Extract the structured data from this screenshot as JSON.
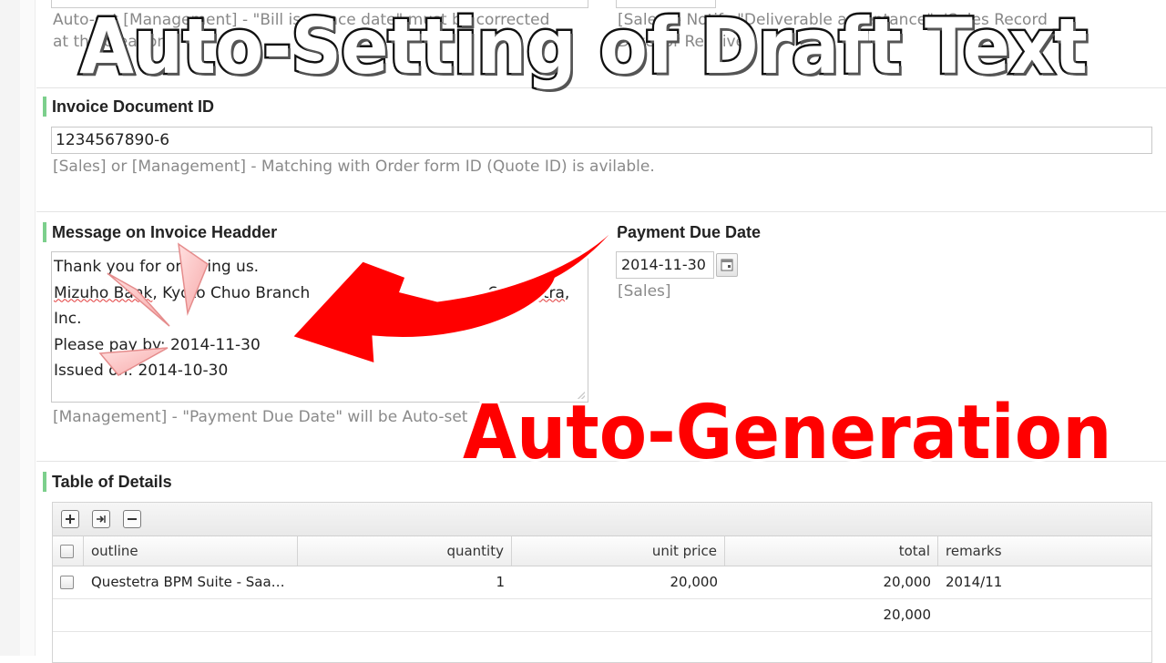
{
  "overlay": {
    "title": "Auto-Setting of Draft Text",
    "generation": "Auto-Generation"
  },
  "top_row": {
    "left_help_line1": "Auto-set [Management] - \"Bill issuance date\" must be corrected",
    "left_help_line2": "at the creation",
    "right_help_line1": "[Sales] - Notify \"Deliverable acceptance\". 'Sales Record",
    "right_help_line2": "Date' or Receive"
  },
  "invoice_id": {
    "label": "Invoice Document ID",
    "value": "1234567890-6",
    "help": "[Sales] or [Management] - Matching with Order form ID (Quote ID) is avilable."
  },
  "message": {
    "label": "Message on Invoice Headder",
    "lines": {
      "l1": "Thank you for ordering us.",
      "l2a": "Mizuho Bank",
      "l2b": ", Kyoto Chuo Branch",
      "l2c": "Questetra",
      "l2d": ",",
      "l3": "Inc.",
      "l4": "Please pay by:  2014-11-30",
      "l5": "Issued on: 2014-10-30"
    },
    "help": "[Management] - \"Payment Due Date\" will be Auto-set"
  },
  "payment_due": {
    "label": "Payment Due Date",
    "value": "2014-11-30",
    "help": "[Sales]"
  },
  "details": {
    "label": "Table of Details",
    "toolbar": {
      "add_icon": "plus-icon",
      "insert_icon": "insert-icon",
      "remove_icon": "minus-icon"
    },
    "columns": {
      "outline": "outline",
      "quantity": "quantity",
      "unit_price": "unit price",
      "total": "total",
      "remarks": "remarks"
    },
    "rows": [
      {
        "outline": "Questetra BPM Suite - Saa…",
        "quantity": "1",
        "unit_price": "20,000",
        "total": "20,000",
        "remarks": "2014/11"
      }
    ],
    "sum_total": "20,000"
  },
  "colors": {
    "accent_bar": "#7ccf8c",
    "arrow": "#ff0000",
    "overlay_generation": "#ff0000"
  }
}
